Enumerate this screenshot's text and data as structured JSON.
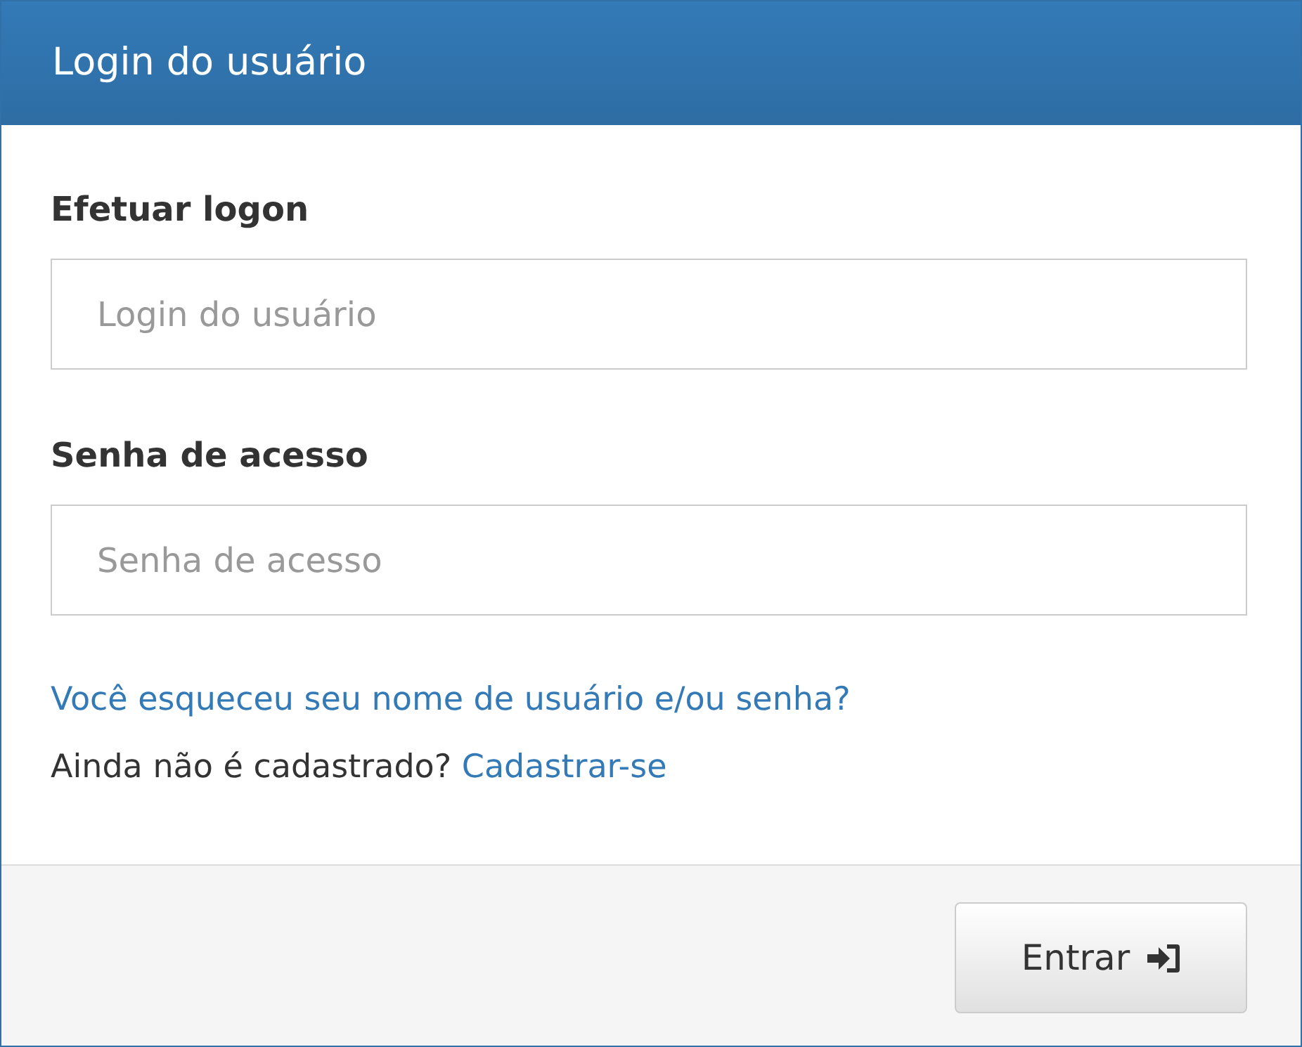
{
  "panel": {
    "title": "Login do usuário"
  },
  "fields": [
    {
      "label": "Efetuar logon",
      "placeholder": "Login do usuário"
    },
    {
      "label": "Senha de acesso",
      "placeholder": "Senha de acesso"
    }
  ],
  "forgot_link": "Você esqueceu seu nome de usuário e/ou senha?",
  "register": {
    "prompt": "Ainda não é cadastrado?",
    "link": "Cadastrar-se"
  },
  "submit_button": {
    "label": "Entrar"
  }
}
